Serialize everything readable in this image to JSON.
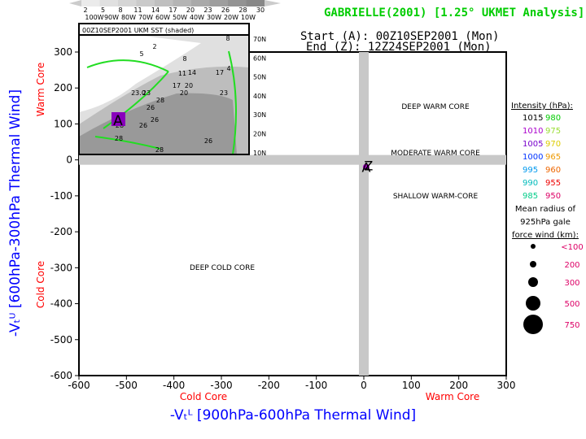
{
  "title": "GABRIELLE(2001) [1.25° UKMET Analysis]",
  "start_label": "Start (A): 00Z10SEP2001 (Mon)",
  "end_label": "End (Z): 12Z24SEP2001 (Mon)",
  "colors": {
    "title": "#00cc00",
    "core_label": "#ff0000",
    "axis_label": "#0000ff"
  },
  "chart_data": {
    "type": "scatter",
    "xlabel": "-Vₜᴸ [900hPa-600hPa Thermal Wind]",
    "ylabel": "-Vₜᵁ [600hPa-300hPa Thermal Wind]",
    "xlim": [
      -600,
      300
    ],
    "ylim": [
      -600,
      300
    ],
    "xticks": [
      -600,
      -500,
      -400,
      -300,
      -200,
      -100,
      0,
      100,
      200,
      300
    ],
    "yticks": [
      300,
      200,
      100,
      0,
      -100,
      -200,
      -300,
      -400,
      -500,
      -600
    ],
    "x_core_labels": [
      "Cold Core",
      "Warm Core"
    ],
    "y_core_labels": [
      "Warm Core",
      "Cold Core"
    ],
    "regions": [
      "DEEP WARM CORE",
      "MODERATE WARM CORE",
      "SHALLOW WARM-CORE",
      "DEEP COLD CORE"
    ],
    "track": [
      {
        "x": 5,
        "y": -20,
        "label": "A",
        "mslp": 1010
      },
      {
        "x": 10,
        "y": -15,
        "label": "Z"
      }
    ],
    "legend": {
      "intensity_title": "Intensity (hPa):",
      "intensity": [
        [
          "1015",
          "#000000"
        ],
        [
          "980",
          "#00cc00"
        ],
        [
          "1010",
          "#aa00cc"
        ],
        [
          "975",
          "#99dd33"
        ],
        [
          "1005",
          "#7700cc"
        ],
        [
          "970",
          "#ddcc00"
        ],
        [
          "1000",
          "#0033ff"
        ],
        [
          "965",
          "#ee9900"
        ],
        [
          "995",
          "#0099ee"
        ],
        [
          "960",
          "#ee6600"
        ],
        [
          "990",
          "#00bbbb"
        ],
        [
          "955",
          "#ee0000"
        ],
        [
          "985",
          "#00cc88"
        ],
        [
          "950",
          "#dd0066"
        ]
      ],
      "radius_title": [
        "Mean radius of",
        "925hPa gale",
        "force wind (km):"
      ],
      "radius": [
        "<100",
        "200",
        "300",
        "500",
        "750"
      ],
      "radius_color": "#dd0066"
    },
    "inset": {
      "title": "00Z10SEP2001 UKM SST (shaded)",
      "colorbar_ticks": [
        "2",
        "5",
        "8",
        "11",
        "14",
        "17",
        "20",
        "23",
        "26",
        "28",
        "30"
      ],
      "lon_labels": [
        "100W",
        "90W",
        "80W",
        "70W",
        "60W",
        "50W",
        "40W",
        "30W",
        "20W",
        "10W"
      ],
      "lat_labels": [
        "70N",
        "60N",
        "50N",
        "40N",
        "30N",
        "20N",
        "10N"
      ],
      "contour_labels": [
        "2",
        "5",
        "8",
        "8",
        "11",
        "14",
        "17",
        "4",
        "17",
        "20",
        "23.0",
        "23",
        "20",
        "23",
        "28",
        "26",
        "26",
        "26",
        "28",
        "28",
        "26",
        "28"
      ]
    }
  }
}
